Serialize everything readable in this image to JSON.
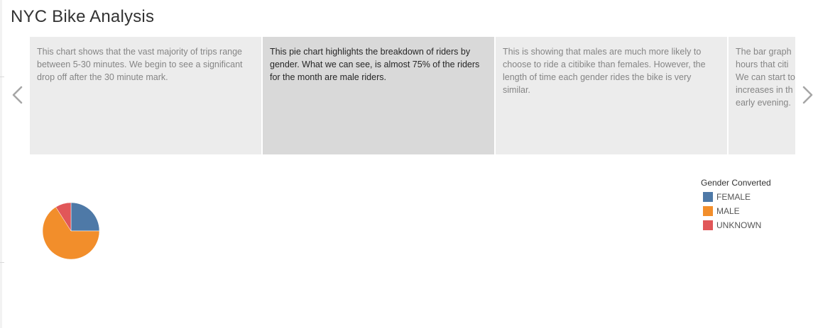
{
  "dashboard": {
    "title": "NYC Bike Analysis"
  },
  "story": {
    "points": [
      {
        "text": "This chart shows that the vast majority of trips range between 5-30 minutes. We begin to see a significant drop off after the 30 minute mark.",
        "selected": false
      },
      {
        "text": "This pie chart highlights the breakdown of riders by gender. What we can see, is almost 75% of the riders for the month are male riders.",
        "selected": true
      },
      {
        "text": "This is showing that males are much more likely to choose to ride a citibike than females. However, the length of time each gender rides the bike is very similar.",
        "selected": false
      },
      {
        "text": "The bar graph hours that citi We can start to increases in th early evening.",
        "selected": false
      }
    ],
    "prev_icon": "chevron-left-icon",
    "next_icon": "chevron-right-icon"
  },
  "legend": {
    "title": "Gender Converted",
    "items": [
      {
        "label": "FEMALE",
        "color": "#4e79a7"
      },
      {
        "label": "MALE",
        "color": "#f28e2b"
      },
      {
        "label": "UNKNOWN",
        "color": "#e15759"
      }
    ]
  },
  "chart_data": {
    "type": "pie",
    "title": "",
    "categories": [
      "FEMALE",
      "MALE",
      "UNKNOWN"
    ],
    "values": [
      25,
      66,
      9
    ],
    "colors": [
      "#4e79a7",
      "#f28e2b",
      "#e15759"
    ]
  }
}
